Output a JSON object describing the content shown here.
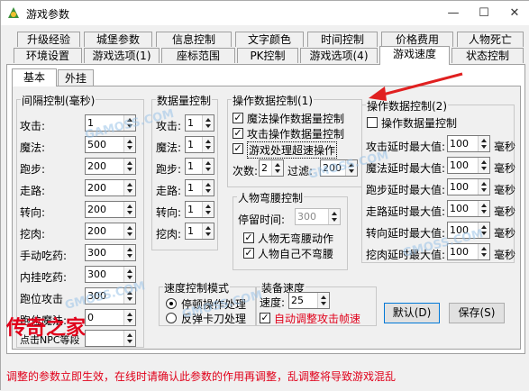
{
  "window": {
    "title": "游戏参数"
  },
  "tabs_row1": [
    "升级经验",
    "城堡参数",
    "信息控制",
    "文字颜色",
    "时间控制",
    "价格费用",
    "人物死亡"
  ],
  "tabs_row2": [
    "环境设置",
    "游戏选项(1)",
    "座标范围",
    "PK控制",
    "游戏选项(4)",
    "游戏速度",
    "状态控制"
  ],
  "subtabs": [
    "基本",
    "外挂"
  ],
  "interval_group": {
    "title": "间隔控制(毫秒)",
    "rows": [
      {
        "label": "攻击:",
        "value": "1"
      },
      {
        "label": "魔法:",
        "value": "500"
      },
      {
        "label": "跑步:",
        "value": "200"
      },
      {
        "label": "走路:",
        "value": "200"
      },
      {
        "label": "转向:",
        "value": "200"
      },
      {
        "label": "挖肉:",
        "value": "200"
      },
      {
        "label": "手动吃药:",
        "value": "300"
      },
      {
        "label": "内挂吃药:",
        "value": "300"
      },
      {
        "label": "跑位攻击",
        "value": "300"
      },
      {
        "label": "跑位魔法:",
        "value": "0"
      },
      {
        "label": "点击NPC等段",
        "value": ""
      }
    ]
  },
  "count_group": {
    "title": "数据量控制",
    "rows": [
      {
        "label": "攻击:",
        "value": "1"
      },
      {
        "label": "魔法:",
        "value": "1"
      },
      {
        "label": "跑步:",
        "value": "1"
      },
      {
        "label": "走路:",
        "value": "1"
      },
      {
        "label": "转向:",
        "value": "1"
      },
      {
        "label": "挖肉:",
        "value": "1"
      }
    ]
  },
  "op1_group": {
    "title": "操作数据控制(1)",
    "checks": [
      {
        "label": "魔法操作数据量控制",
        "checked": true
      },
      {
        "label": "攻击操作数据量控制",
        "checked": true
      },
      {
        "label": "游戏处理超速操作",
        "checked": true
      }
    ],
    "times_label": "次数:",
    "times_value": "2",
    "filter_label": "过滤:",
    "filter_value": "200"
  },
  "bow_group": {
    "title": "人物弯腰控制",
    "stop_label": "停留时间:",
    "stop_value": "300",
    "checks": [
      {
        "label": "人物无弯腰动作",
        "checked": true
      },
      {
        "label": "人物自己不弯腰",
        "checked": true
      }
    ]
  },
  "op2_group": {
    "title": "操作数据控制(2)",
    "check_label": "操作数据量控制",
    "rows": [
      {
        "label": "攻击延时最大值:",
        "value": "100",
        "unit": "毫秒"
      },
      {
        "label": "魔法延时最大值:",
        "value": "100",
        "unit": "毫秒"
      },
      {
        "label": "跑步延时最大值:",
        "value": "100",
        "unit": "毫秒"
      },
      {
        "label": "走路延时最大值:",
        "value": "100",
        "unit": "毫秒"
      },
      {
        "label": "转向延时最大值:",
        "value": "100",
        "unit": "毫秒"
      },
      {
        "label": "挖肉延时最大值:",
        "value": "100",
        "unit": "毫秒"
      }
    ]
  },
  "speed_mode": {
    "title": "速度控制模式",
    "options": [
      {
        "label": "停顿操作处理",
        "selected": true
      },
      {
        "label": "反弹卡刀处理",
        "selected": false
      }
    ]
  },
  "equip_speed": {
    "title": "装备速度",
    "speed_label": "速度:",
    "speed_value": "25",
    "auto_label": "自动调整攻击帧速",
    "auto_checked": true
  },
  "buttons": {
    "default": "默认(D)",
    "save": "保存(S)"
  },
  "status_text": "调整的参数立即生效，在线时请确认此参数的作用再调整，乱调整将导致游戏混乱",
  "watermarks": [
    "GAMOSS.COM",
    "GMOSS.COM",
    "GMOSS.COM",
    "GMOSS.COM",
    "GMOSS.COM"
  ],
  "overlay_logo": "传奇之家",
  "colors": {
    "accent": "#0078d7",
    "warning": "#e0001a",
    "arrow": "#e02020"
  }
}
